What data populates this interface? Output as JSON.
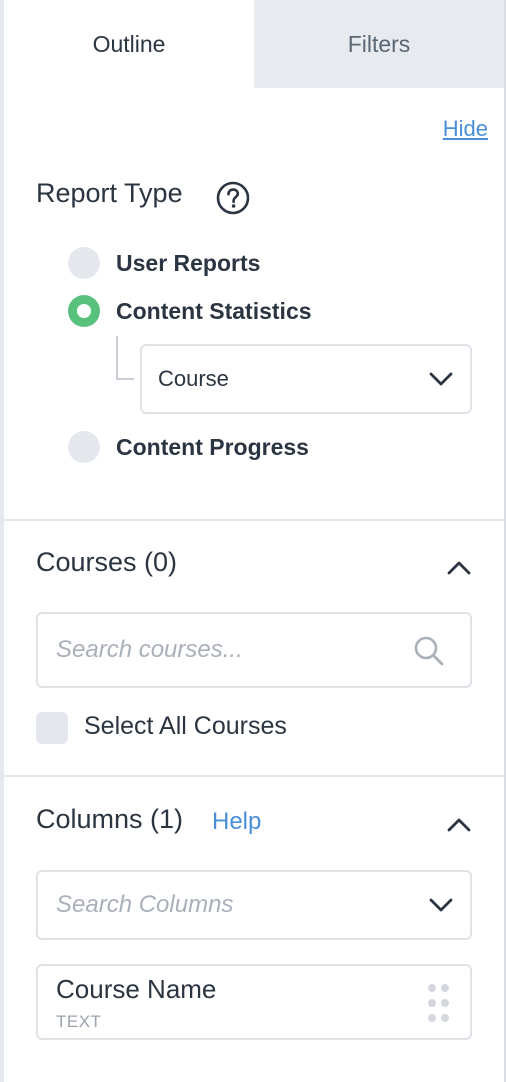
{
  "tabs": [
    {
      "label": "Outline",
      "active": true
    },
    {
      "label": "Filters",
      "active": false
    }
  ],
  "hide_link": "Hide",
  "report_type": {
    "title": "Report Type",
    "help_icon": "question-circle-icon",
    "options": [
      {
        "label": "User Reports",
        "selected": false
      },
      {
        "label": "Content Statistics",
        "selected": true
      },
      {
        "label": "Content Progress",
        "selected": false
      }
    ],
    "content_select": {
      "value": "Course",
      "icon": "chevron-down-icon"
    }
  },
  "courses": {
    "title": "Courses (0)",
    "collapse_icon": "chevron-up-icon",
    "search_placeholder": "Search courses...",
    "search_icon": "search-icon",
    "select_all_label": "Select All Courses",
    "select_all_checked": false
  },
  "columns": {
    "title": "Columns (1)",
    "help_link": "Help",
    "collapse_icon": "chevron-up-icon",
    "search_placeholder": "Search Columns",
    "items": [
      {
        "name": "Course Name",
        "type": "TEXT",
        "handle_icon": "drag-handle-icon"
      }
    ]
  },
  "colors": {
    "accent_green": "#58c27d",
    "link_blue": "#4a8fd6",
    "text_dark": "#2b3542"
  }
}
